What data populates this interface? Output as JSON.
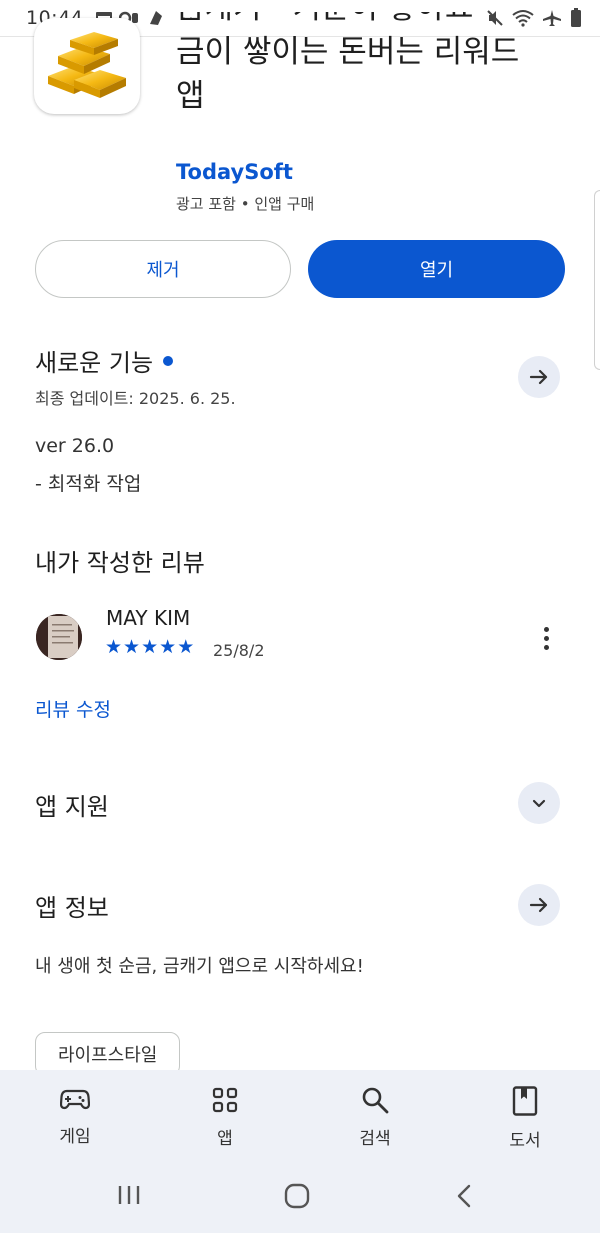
{
  "status_bar": {
    "time": "10:44",
    "extra": "··"
  },
  "app": {
    "title_line1": "금캐기 - 기분이 좋아요",
    "title_line2": "금이 쌓이는 돈버는 리워드",
    "title_line3": "앱",
    "developer": "TodaySoft",
    "meta": "광고 포함 • 인앱 구매",
    "icon": "gold-bars-icon"
  },
  "actions": {
    "remove_label": "제거",
    "open_label": "열기"
  },
  "whats_new": {
    "title": "새로운 기능",
    "updated": "최종 업데이트: 2025. 6. 25.",
    "version": "ver 26.0",
    "notes": "- 최적화 작업"
  },
  "my_review": {
    "title": "내가 작성한 리뷰",
    "reviewer": "MAY KIM",
    "rating": 5,
    "stars": [
      "★",
      "★",
      "★",
      "★",
      "★"
    ],
    "date": "25/8/2",
    "edit_label": "리뷰 수정"
  },
  "app_support": {
    "title": "앱 지원"
  },
  "app_info": {
    "title": "앱 정보",
    "description": "내 생애 첫 순금, 금캐기 앱으로 시작하세요!",
    "category_chip": "라이프스타일"
  },
  "bottom_nav": [
    {
      "label": "게임",
      "icon": "gamepad-icon"
    },
    {
      "label": "앱",
      "icon": "apps-grid-icon"
    },
    {
      "label": "검색",
      "icon": "search-icon"
    },
    {
      "label": "도서",
      "icon": "book-icon"
    }
  ],
  "colors": {
    "accent": "#0b57d0",
    "nav_bg": "#eef1f7",
    "round_btn_bg": "#e8ecf5"
  }
}
